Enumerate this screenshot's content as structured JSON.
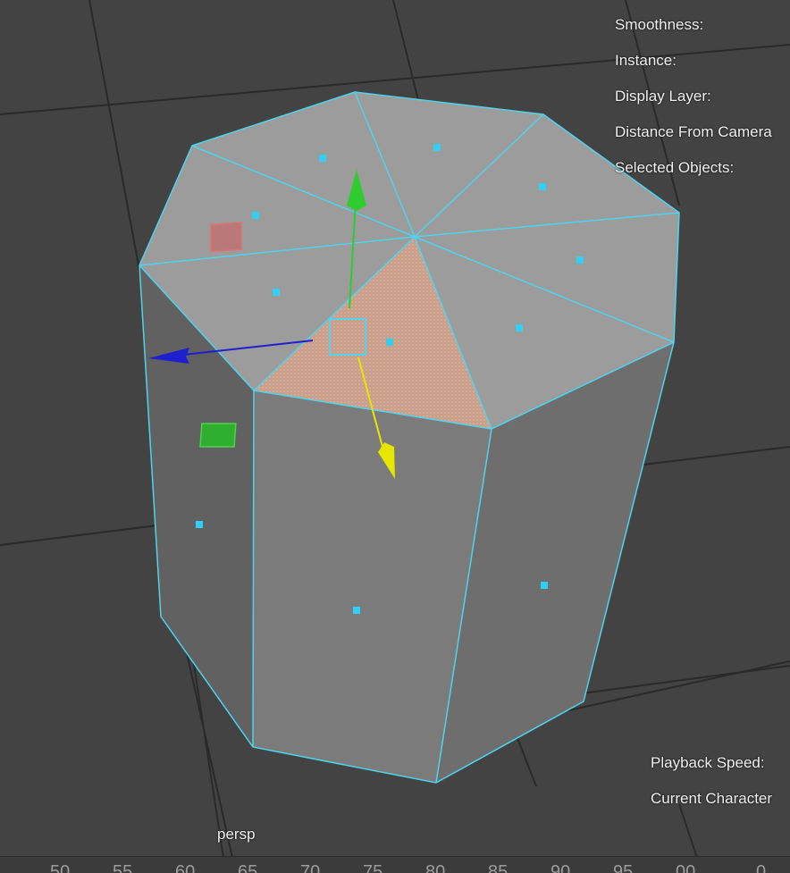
{
  "viewport": {
    "camera_name": "persp",
    "hud_top": [
      {
        "key": "smoothness",
        "label": "Smoothness:"
      },
      {
        "key": "instance",
        "label": "Instance:"
      },
      {
        "key": "display_layer",
        "label": "Display Layer:"
      },
      {
        "key": "distance_from_camera",
        "label": "Distance From Camera"
      },
      {
        "key": "selected_objects",
        "label": "Selected Objects:"
      }
    ],
    "hud_bottom": [
      {
        "key": "playback_speed",
        "label": "Playback Speed:"
      },
      {
        "key": "current_character",
        "label": "Current Character"
      }
    ]
  },
  "timeline": {
    "ticks": [
      "50",
      "55",
      "60",
      "65",
      "70",
      "75",
      "80",
      "85",
      "90",
      "95",
      "00",
      "0"
    ]
  },
  "colors": {
    "wireframe": "#4fd3ee",
    "selected_face": "#d9a088",
    "move_x": "#1f1fd0",
    "move_y": "#2ecc2e",
    "move_z": "#e6e600",
    "scale_handle_red": "#d06060",
    "scale_handle_green": "#2fae2f",
    "grid_line": "#262626",
    "viewport_bg": "#434343"
  }
}
